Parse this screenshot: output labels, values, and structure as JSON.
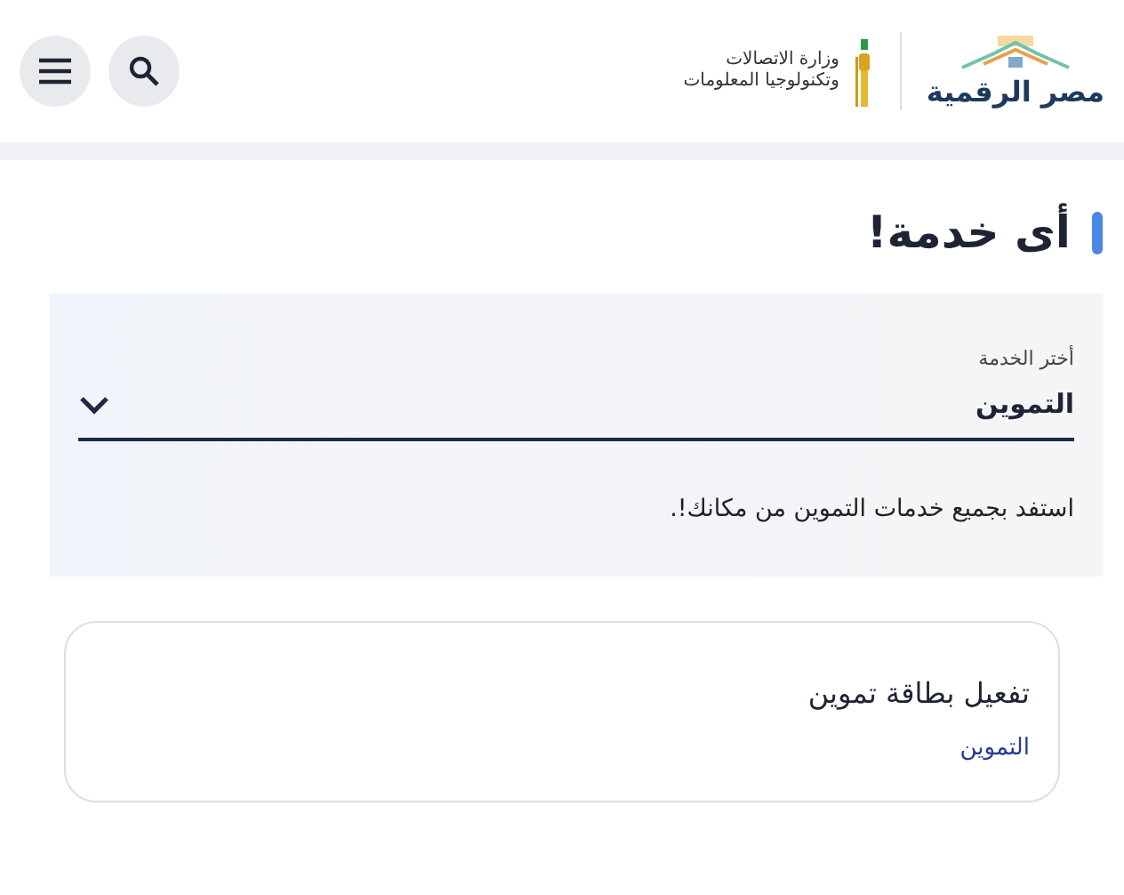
{
  "header": {
    "logo_text": "مصر الرقمية",
    "ministry_lines": [
      "وزارة الاتصالات",
      "وتكنولوجيا المعلومات"
    ]
  },
  "title": "أى خدمة!",
  "service_select": {
    "label": "أختر الخدمة",
    "value": "التموين"
  },
  "description": "استفد بجميع خدمات التموين من مكانك!.",
  "cards": [
    {
      "title": "تفعيل بطاقة تموين",
      "category": "التموين"
    }
  ]
}
